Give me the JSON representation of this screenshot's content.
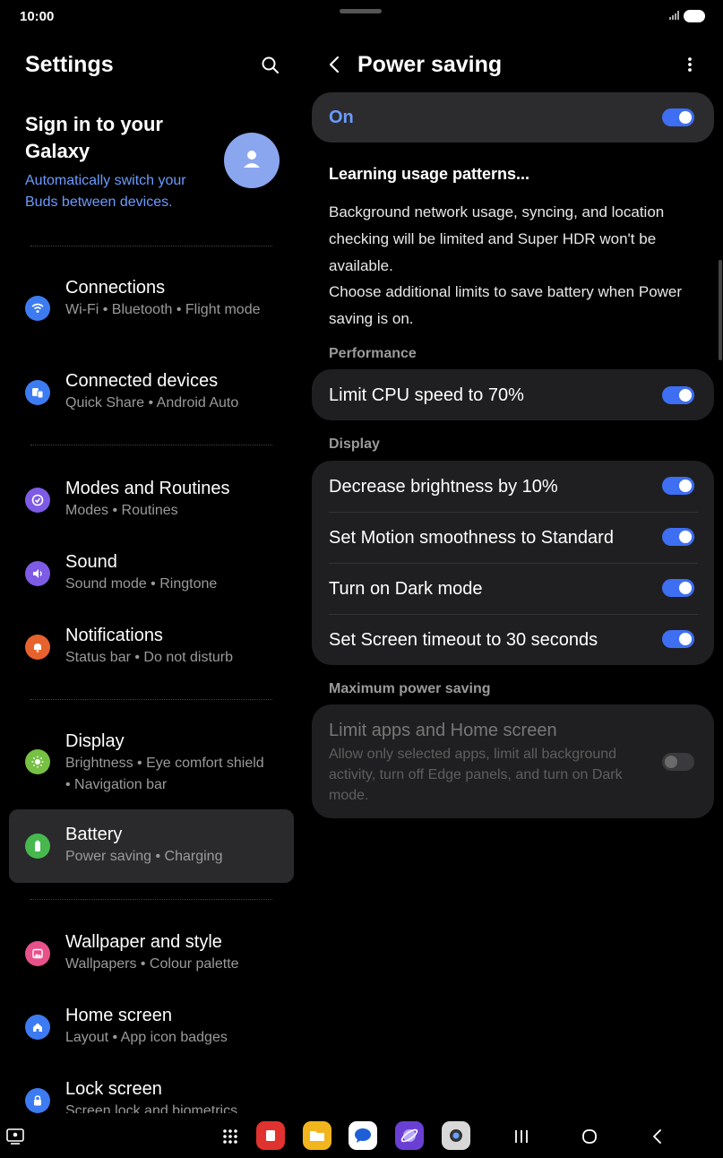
{
  "status_bar": {
    "time": "10:00"
  },
  "left": {
    "title": "Settings",
    "account": {
      "title": "Sign in to your Galaxy",
      "subtitle": "Automatically switch your Buds between devices."
    },
    "items": [
      {
        "title": "Connections",
        "sub": "Wi-Fi  •  Bluetooth  •  Flight mode",
        "icon": "wifi-icon",
        "color": "#3d7bf2"
      },
      {
        "title": "Connected devices",
        "sub": "Quick Share  •  Android Auto",
        "icon": "devices-icon",
        "color": "#3d7bf2"
      },
      {
        "title": "Modes and Routines",
        "sub": "Modes  •  Routines",
        "icon": "modes-icon",
        "color": "#7d5be4"
      },
      {
        "title": "Sound",
        "sub": "Sound mode  •  Ringtone",
        "icon": "speaker-icon",
        "color": "#7d5be4"
      },
      {
        "title": "Notifications",
        "sub": "Status bar  •  Do not disturb",
        "icon": "bell-icon",
        "color": "#e7632d"
      },
      {
        "title": "Display",
        "sub": "Brightness  •  Eye comfort shield  •  Navigation bar",
        "icon": "sun-icon",
        "color": "#76c043"
      },
      {
        "title": "Battery",
        "sub": "Power saving  •  Charging",
        "icon": "battery-icon",
        "color": "#47b84e"
      },
      {
        "title": "Wallpaper and style",
        "sub": "Wallpapers  •  Colour palette",
        "icon": "wallpaper-icon",
        "color": "#e8518a"
      },
      {
        "title": "Home screen",
        "sub": "Layout  •  App icon badges",
        "icon": "home-icon",
        "color": "#3d7bf2"
      },
      {
        "title": "Lock screen",
        "sub": "Screen lock and biometrics",
        "icon": "lock-icon",
        "color": "#3d7bf2"
      }
    ]
  },
  "right": {
    "title": "Power saving",
    "master": {
      "label": "On",
      "on": true
    },
    "info_heading": "Learning usage patterns...",
    "info_body_1": "Background network usage, syncing, and location checking will be limited and Super HDR won't be available.",
    "info_body_2": "Choose additional limits to save battery when Power saving is on.",
    "performance_label": "Performance",
    "cpu": {
      "label": "Limit CPU speed to 70%",
      "on": true
    },
    "display_label": "Display",
    "display_items": [
      {
        "label": "Decrease brightness by 10%",
        "on": true
      },
      {
        "label": "Set Motion smoothness to Standard",
        "on": true
      },
      {
        "label": "Turn on Dark mode",
        "on": true
      },
      {
        "label": "Set Screen timeout to 30 seconds",
        "on": true
      }
    ],
    "max_label": "Maximum power saving",
    "max": {
      "title": "Limit apps and Home screen",
      "sub": "Allow only selected apps, limit all background activity, turn off Edge panels, and turn on Dark mode.",
      "on": false
    }
  },
  "colors": {
    "accent": "#3e6ff2",
    "link": "#6b9bff",
    "card": "#1f1f21"
  }
}
